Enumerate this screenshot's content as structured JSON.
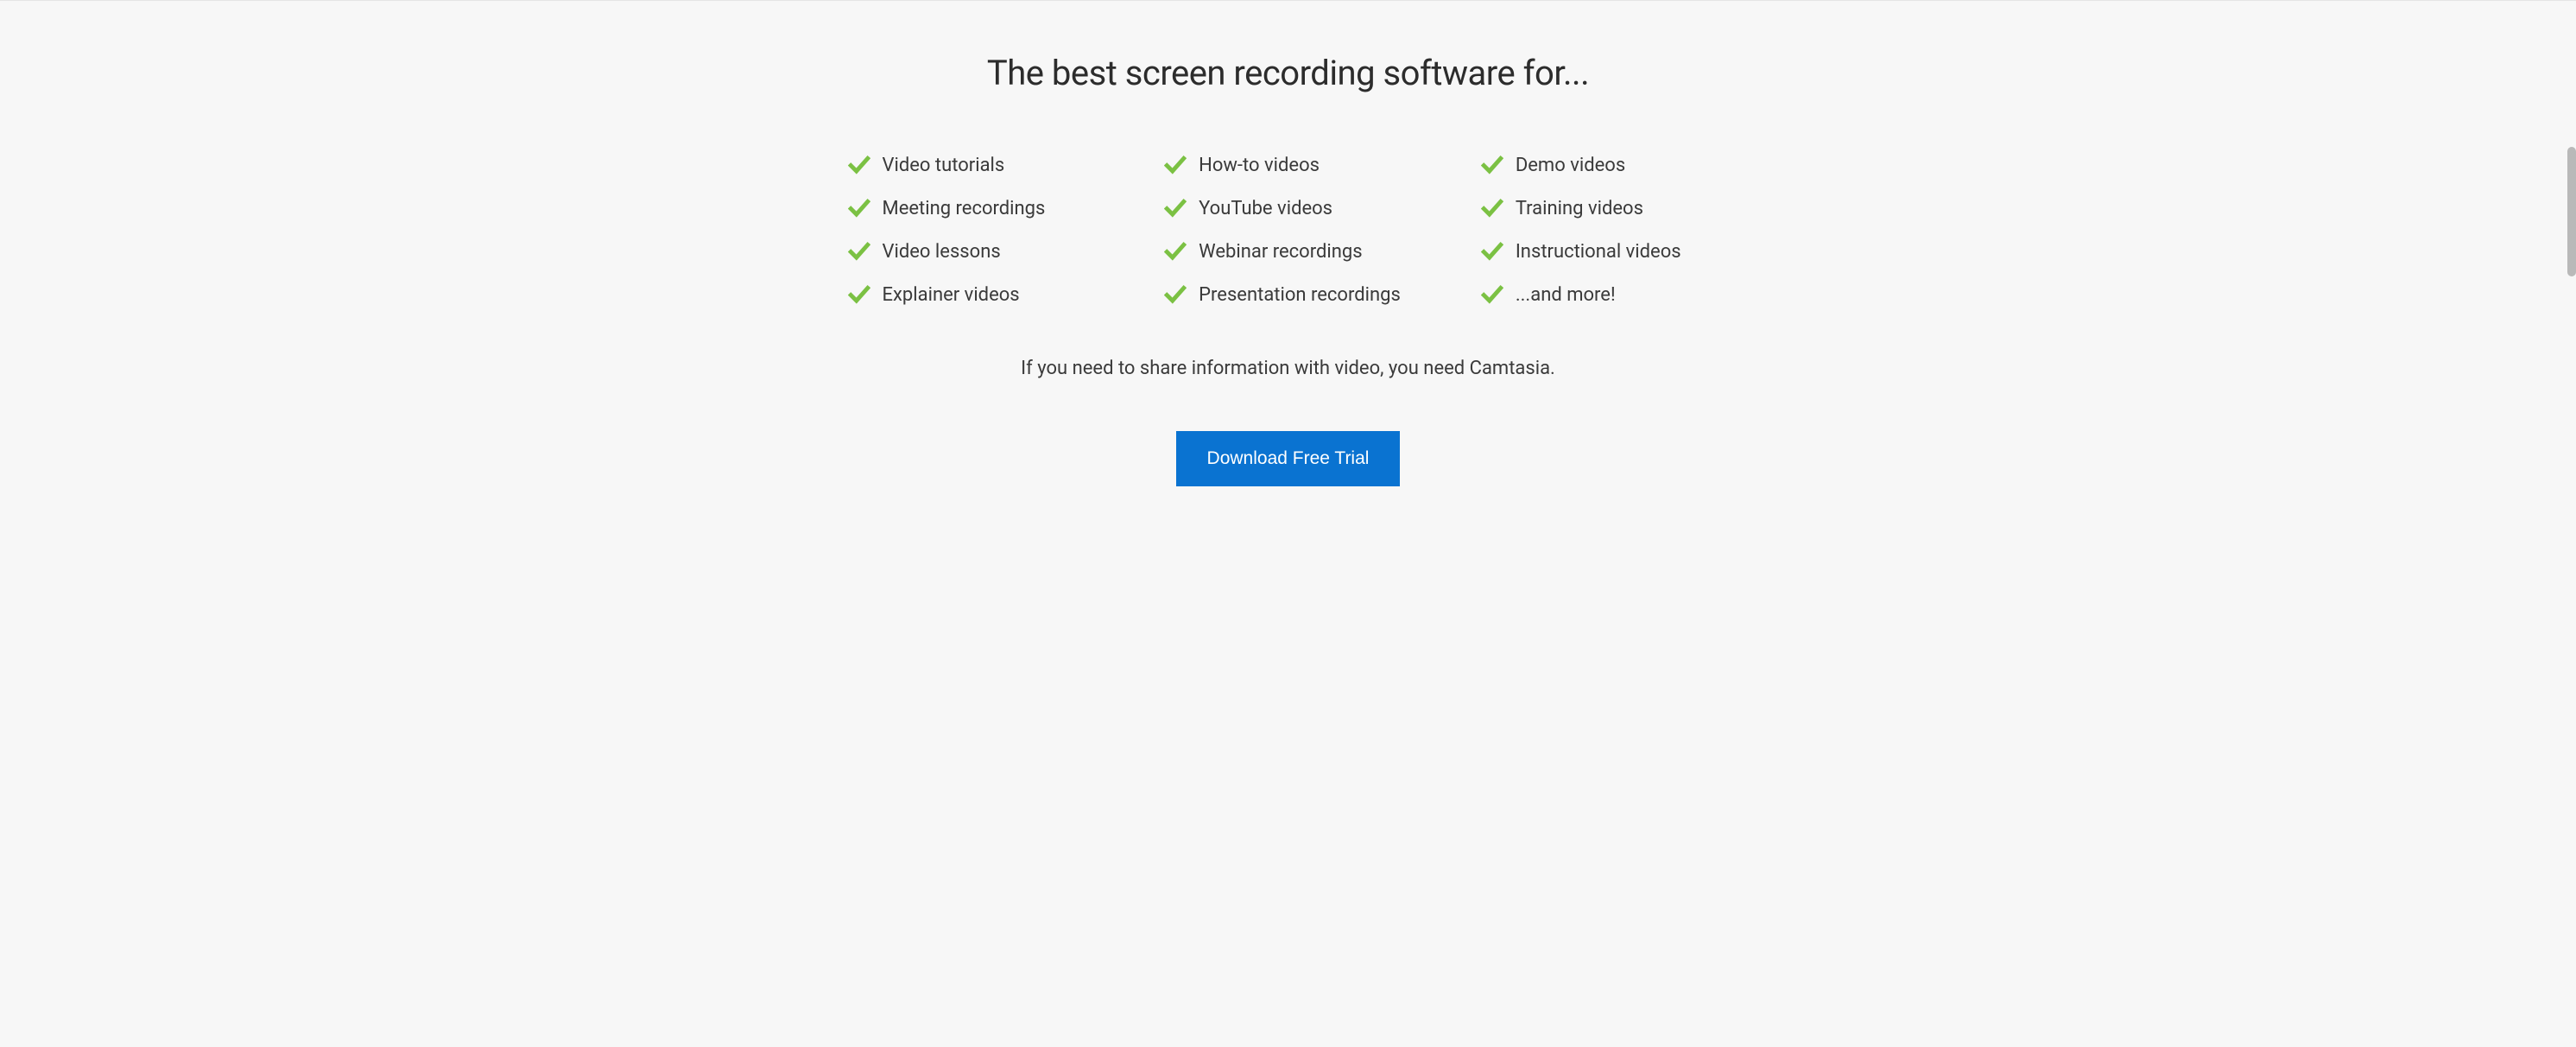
{
  "heading": "The best screen recording software for...",
  "features": {
    "col1": [
      "Video tutorials",
      "Meeting recordings",
      "Video lessons",
      "Explainer videos"
    ],
    "col2": [
      "How-to videos",
      "YouTube videos",
      "Webinar recordings",
      "Presentation recordings"
    ],
    "col3": [
      "Demo videos",
      "Training videos",
      "Instructional videos",
      "...and more!"
    ]
  },
  "tagline": "If you need to share information with video, you need Camtasia.",
  "cta_label": "Download Free Trial",
  "colors": {
    "check": "#7bc143",
    "button_bg": "#0a73d1",
    "button_text": "#ffffff"
  }
}
